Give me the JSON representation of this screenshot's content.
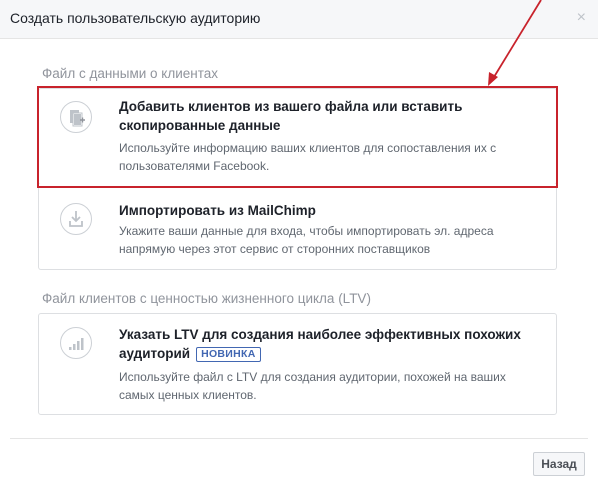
{
  "dialog": {
    "title": "Создать пользовательскую аудиторию",
    "close_glyph": "×"
  },
  "sections": [
    {
      "label": "Файл с данными о клиентах",
      "options": [
        {
          "icon": "file-add-icon",
          "title": "Добавить клиентов из вашего файла или вставить скопированные данные",
          "description": "Используйте информацию ваших клиентов для сопоставления их с пользователями Facebook.",
          "highlighted": true
        },
        {
          "icon": "import-icon",
          "title": "Импортировать из MailChimp",
          "description": "Укажите ваши данные для входа, чтобы импортировать эл. адреса напрямую через этот сервис от сторонних поставщиков",
          "highlighted": false
        }
      ]
    },
    {
      "label": "Файл клиентов с ценностью жизненного цикла (LTV)",
      "options": [
        {
          "icon": "bar-chart-icon",
          "title": "Указать LTV для создания наиболее эффективных похожих аудиторий",
          "badge": "НОВИНКА",
          "description": "Используйте файл с LTV для создания аудитории, похожей на ваших самых ценных клиентов.",
          "highlighted": false
        }
      ]
    }
  ],
  "footer": {
    "back_label": "Назад"
  },
  "colors": {
    "highlight_border": "#c8232c",
    "badge": "#4267b2",
    "muted_text": "#90949c"
  }
}
